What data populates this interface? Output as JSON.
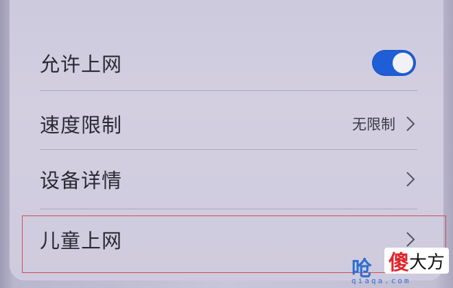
{
  "settings": {
    "allow_internet": {
      "label": "允许上网",
      "enabled": true
    },
    "speed_limit": {
      "label": "速度限制",
      "value": "无限制"
    },
    "device_details": {
      "label": "设备详情"
    },
    "kids_internet": {
      "label": "儿童上网"
    }
  },
  "colors": {
    "toggle_on": "#1f5ed6",
    "highlight_border": "#d14a55",
    "card_bg": "#d3cfe1"
  },
  "watermark": {
    "badge_char": "傻",
    "badge_rest": "大方",
    "domain": "qiaqa.com"
  },
  "icons": {
    "chevron": "chevron-right-icon",
    "toggle": "toggle-switch"
  }
}
